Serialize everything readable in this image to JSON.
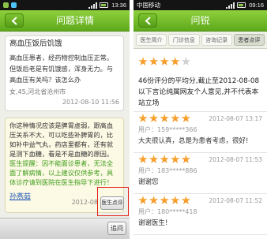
{
  "colors": {
    "header_green_top": "#8fd03c",
    "header_green_bottom": "#5ea91c",
    "star_light": "#ffb347",
    "star_dark": "#f08a12",
    "reminder_green": "#3f9e1c",
    "doctor_link": "#2157b5",
    "highlight_red": "#e3201b"
  },
  "left": {
    "status": {
      "time": "13:36",
      "icons": [
        "notification-icon",
        "notification-icon",
        "signal-icon",
        "battery-icon"
      ]
    },
    "header": {
      "title": "问题详情",
      "back_icon": "back-arrow-icon"
    },
    "question": {
      "title": "高血压饭后饥饿",
      "body": "高血压患者，经药物控制血压正常。但饭后老是有饥饿感，浑身无力。与高血压有关吗？该怎么办",
      "patient": "女,45,河北省沧州市",
      "time": "2012-08-10 11:56"
    },
    "answer": {
      "body": "你这种情况应该是脾胃虚弱，跟高血压关系不大，可以吃些补脾胃的，比如补中益气丸，药店里都有，还有就是测下血糖，看是不是血糖的原因。",
      "reminder": "医生提醒：因不能面诊患者，无法全面了解病情，以上建议仅供参考，具体诊疗请到医院在医生指导下进行！",
      "doctor": "孙燕茹",
      "time": "2012-08",
      "review_button": "医生点评"
    },
    "bottom_bar": {
      "follow_up_button": "追问"
    }
  },
  "right": {
    "status": {
      "carrier": "中国移动",
      "time": "09:16",
      "icons": [
        "signal-icon",
        "battery-icon"
      ]
    },
    "header": {
      "title": "问锐",
      "back_icon": "back-arrow-icon"
    },
    "tabs": [
      {
        "label": "医生简介",
        "selected": false
      },
      {
        "label": "门诊信息",
        "selected": false
      },
      {
        "label": "咨询记录",
        "selected": false
      },
      {
        "label": "患者点评",
        "selected": true
      }
    ],
    "summary": {
      "rating": 4,
      "max_rating": 5,
      "text": "46份评分的平均分,截止至2012-08-08以下言论纯属网友个人意见,并不代表本站立场"
    },
    "reviews": [
      {
        "rating": 5,
        "time": "2012-08-07 13:17",
        "user": "用户：159*****366",
        "comment": "大夫很认真，总是为患者考虑，很好!"
      },
      {
        "rating": 5,
        "time": "2012-08-07 11:53",
        "user": "用户：183*****886",
        "comment": "谢谢您"
      },
      {
        "rating": 5,
        "time": "2012-08-07 11:52",
        "user": "用户：180*****418",
        "comment": "谢谢医生!"
      }
    ]
  }
}
